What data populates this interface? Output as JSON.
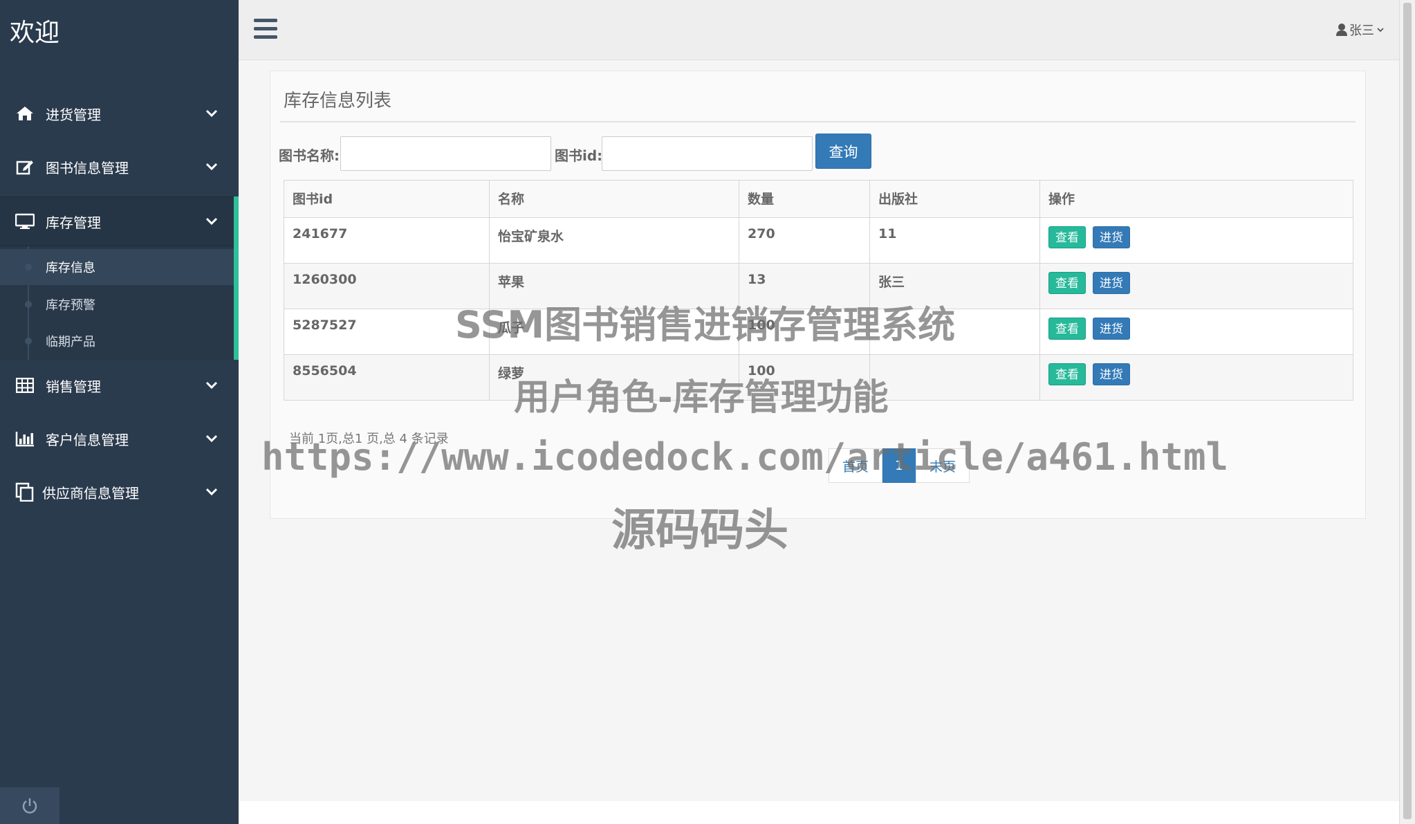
{
  "brand": "欢迎",
  "sidebar": {
    "items": [
      {
        "label": "进货管理",
        "icon": "home-icon"
      },
      {
        "label": "图书信息管理",
        "icon": "edit-icon"
      },
      {
        "label": "库存管理",
        "icon": "desktop-icon"
      },
      {
        "label": "销售管理",
        "icon": "table-icon"
      },
      {
        "label": "客户信息管理",
        "icon": "bar-chart-icon"
      },
      {
        "label": "供应商信息管理",
        "icon": "copy-icon"
      }
    ],
    "subitems": [
      {
        "label": "库存信息"
      },
      {
        "label": "库存预警"
      },
      {
        "label": "临期产品"
      }
    ]
  },
  "header": {
    "user": "张三"
  },
  "panel": {
    "title": "库存信息列表",
    "search": {
      "name_label": "图书名称:",
      "name_value": "",
      "id_label": "图书id:",
      "id_value": "",
      "query_label": "查询"
    },
    "table": {
      "columns": [
        "图书id",
        "名称",
        "数量",
        "出版社",
        "操作"
      ],
      "rows": [
        {
          "id": "241677",
          "name": "怡宝矿泉水",
          "qty": "270",
          "publisher": "11"
        },
        {
          "id": "1260300",
          "name": "苹果",
          "qty": "13",
          "publisher": "张三"
        },
        {
          "id": "5287527",
          "name": "瓜子",
          "qty": "100",
          "publisher": ""
        },
        {
          "id": "8556504",
          "name": "绿萝",
          "qty": "100",
          "publisher": ""
        }
      ],
      "view_label": "查看",
      "stock_label": "进货"
    },
    "page_info": "当前 1页,总1 页,总 4 条记录",
    "pager": {
      "first": "首页",
      "current": "1",
      "last": "末页"
    }
  },
  "watermark": {
    "line1": "SSM图书销售进销存管理系统",
    "line2": "用户角色-库存管理功能",
    "line3": "https://www.icodedock.com/article/a461.html",
    "line4": "源码码头"
  }
}
